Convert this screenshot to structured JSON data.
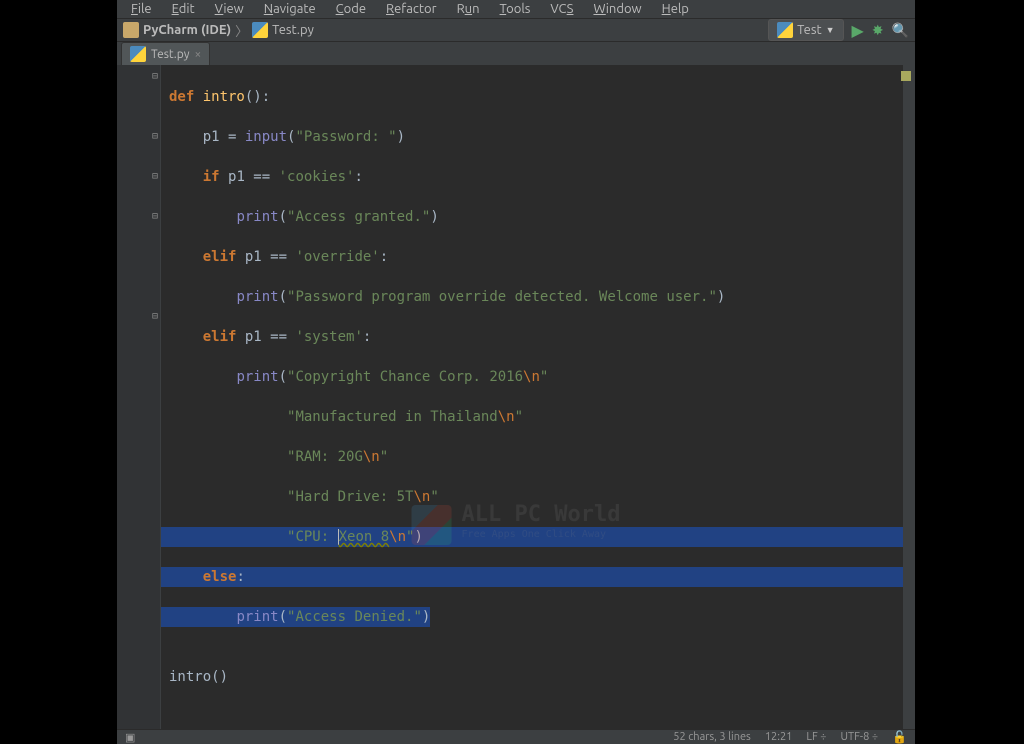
{
  "menu": {
    "file": "File",
    "edit": "Edit",
    "view": "View",
    "navigate": "Navigate",
    "code": "Code",
    "refactor": "Refactor",
    "run": "Run",
    "tools": "Tools",
    "vcs": "VCS",
    "window": "Window",
    "help": "Help"
  },
  "breadcrumb": {
    "project": "PyCharm (IDE)",
    "file": "Test.py"
  },
  "runConfig": "Test",
  "tab": {
    "name": "Test.py"
  },
  "code": {
    "l1": {
      "def": "def ",
      "name": "intro",
      "paren": "():"
    },
    "l2": {
      "indent": "    ",
      "var": "p1 = ",
      "fn": "input",
      "open": "(",
      "str": "\"Password: \"",
      "close": ")"
    },
    "l3": {
      "indent": "    ",
      "kw": "if ",
      "cond": "p1 == ",
      "str": "'cookies'",
      "colon": ":"
    },
    "l4": {
      "indent": "        ",
      "fn": "print",
      "open": "(",
      "str": "\"Access granted.\"",
      "close": ")"
    },
    "l5": {
      "indent": "    ",
      "kw": "elif ",
      "cond": "p1 == ",
      "str": "'override'",
      "colon": ":"
    },
    "l6": {
      "indent": "        ",
      "fn": "print",
      "open": "(",
      "str": "\"Password program override detected. Welcome user.\"",
      "close": ")"
    },
    "l7": {
      "indent": "    ",
      "kw": "elif ",
      "cond": "p1 == ",
      "str": "'system'",
      "colon": ":"
    },
    "l8": {
      "indent": "        ",
      "fn": "print",
      "open": "(",
      "str": "\"Copyright Chance Corp. 2016",
      "esc": "\\n",
      "strend": "\""
    },
    "l9": {
      "indent": "              ",
      "str": "\"Manufactured in Thailand",
      "esc": "\\n",
      "strend": "\""
    },
    "l10": {
      "indent": "              ",
      "str": "\"RAM: 20G",
      "esc": "\\n",
      "strend": "\""
    },
    "l11": {
      "indent": "              ",
      "str": "\"Hard Drive: 5T",
      "esc": "\\n",
      "strend": "\""
    },
    "l12": {
      "indent": "              ",
      "str1": "\"CPU: ",
      "word": "Xeon 8",
      "esc": "\\n",
      "strend": "\"",
      "close": ")"
    },
    "l13": {
      "indent": "    ",
      "kw": "else",
      "colon": ":"
    },
    "l14": {
      "indent": "        ",
      "fn": "print",
      "open": "(",
      "str": "\"Access Denied.\"",
      "close": ")"
    },
    "l16": {
      "call": "intro()"
    }
  },
  "status": {
    "sel": "52 chars, 3 lines",
    "pos": "12:21",
    "lf": "LF",
    "enc": "UTF-8"
  },
  "watermark": {
    "title": "ALL PC World",
    "sub": "Free Apps One Click Away"
  }
}
